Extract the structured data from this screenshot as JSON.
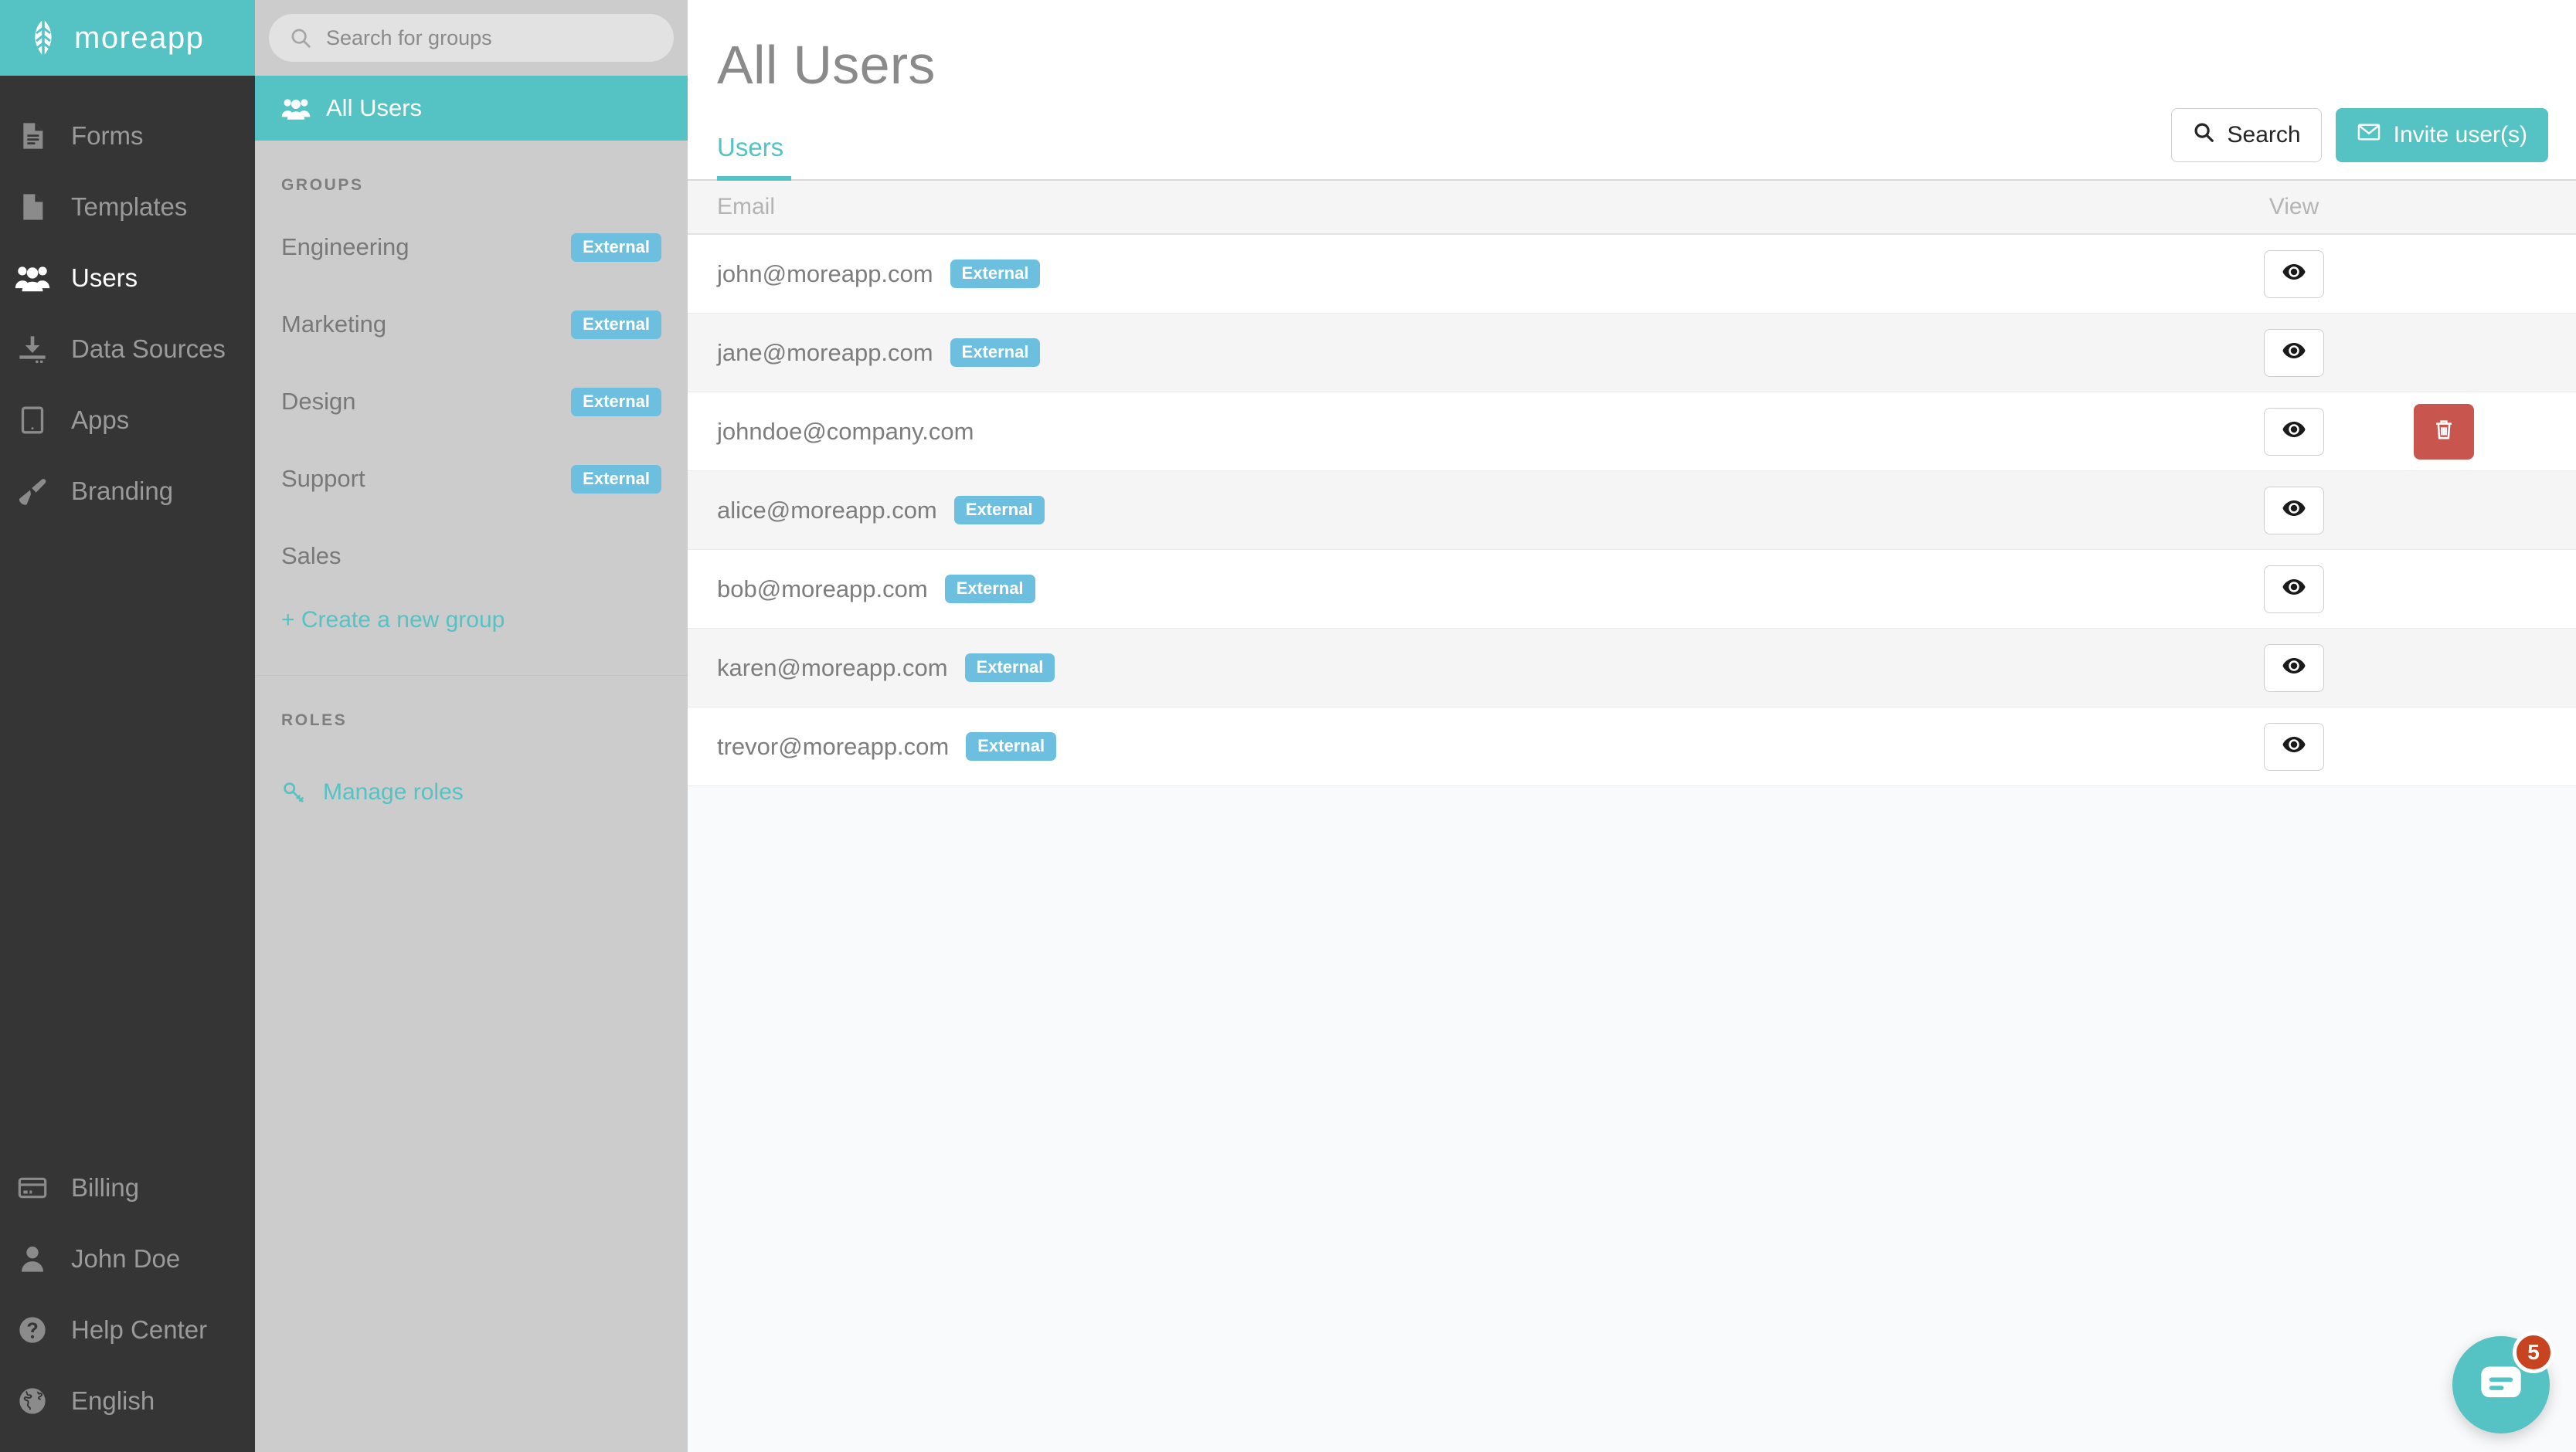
{
  "brand": {
    "name": "moreapp",
    "logo_icon": "leaf-logo-icon"
  },
  "nav": {
    "top_items": [
      {
        "label": "Forms",
        "icon": "document-lines-icon",
        "active": false
      },
      {
        "label": "Templates",
        "icon": "document-icon",
        "active": false
      },
      {
        "label": "Users",
        "icon": "users-group-icon",
        "active": true
      },
      {
        "label": "Data Sources",
        "icon": "download-tray-icon",
        "active": false
      },
      {
        "label": "Apps",
        "icon": "tablet-icon",
        "active": false
      },
      {
        "label": "Branding",
        "icon": "paintbrush-icon",
        "active": false
      }
    ],
    "bottom_items": [
      {
        "label": "Billing",
        "icon": "credit-card-icon",
        "active": false
      },
      {
        "label": "John Doe",
        "icon": "user-icon",
        "active": false
      },
      {
        "label": "Help Center",
        "icon": "question-circle-icon",
        "active": false
      },
      {
        "label": "English",
        "icon": "globe-icon",
        "active": false
      }
    ]
  },
  "groups_panel": {
    "search": {
      "placeholder": "Search for groups",
      "value": "",
      "icon": "search-icon"
    },
    "all_users": {
      "label": "All Users",
      "icon": "users-group-icon",
      "selected": true
    },
    "groups_heading": "GROUPS",
    "groups": [
      {
        "name": "Engineering",
        "badge": "External"
      },
      {
        "name": "Marketing",
        "badge": "External"
      },
      {
        "name": "Design",
        "badge": "External"
      },
      {
        "name": "Support",
        "badge": "External"
      },
      {
        "name": "Sales",
        "badge": ""
      }
    ],
    "create_group_label": "+ Create a new group",
    "roles_heading": "ROLES",
    "manage_roles_label": "Manage roles",
    "manage_roles_icon": "key-icon"
  },
  "main": {
    "page_title": "All Users",
    "tabs": [
      {
        "label": "Users",
        "active": true
      }
    ],
    "actions": {
      "search": {
        "label": "Search",
        "icon": "search-icon"
      },
      "invite": {
        "label": "Invite user(s)",
        "icon": "envelope-icon"
      }
    },
    "table": {
      "columns": {
        "email": "Email",
        "view": "View"
      },
      "view_icon": "eye-icon",
      "delete_icon": "trash-icon",
      "rows": [
        {
          "email": "john@moreapp.com",
          "badge": "External",
          "deletable": false
        },
        {
          "email": "jane@moreapp.com",
          "badge": "External",
          "deletable": false
        },
        {
          "email": "johndoe@company.com",
          "badge": "",
          "deletable": true
        },
        {
          "email": "alice@moreapp.com",
          "badge": "External",
          "deletable": false
        },
        {
          "email": "bob@moreapp.com",
          "badge": "External",
          "deletable": false
        },
        {
          "email": "karen@moreapp.com",
          "badge": "External",
          "deletable": false
        },
        {
          "email": "trevor@moreapp.com",
          "badge": "External",
          "deletable": false
        }
      ]
    }
  },
  "chat": {
    "icon": "chat-bubble-icon",
    "badge_count": "5"
  },
  "colors": {
    "accent": "#55c2c3",
    "nav_bg": "#353535",
    "groups_bg": "#cccccc",
    "badge_external": "#6cbfdf",
    "delete_red": "#c9564e",
    "chat_badge_red": "#c8431f"
  }
}
